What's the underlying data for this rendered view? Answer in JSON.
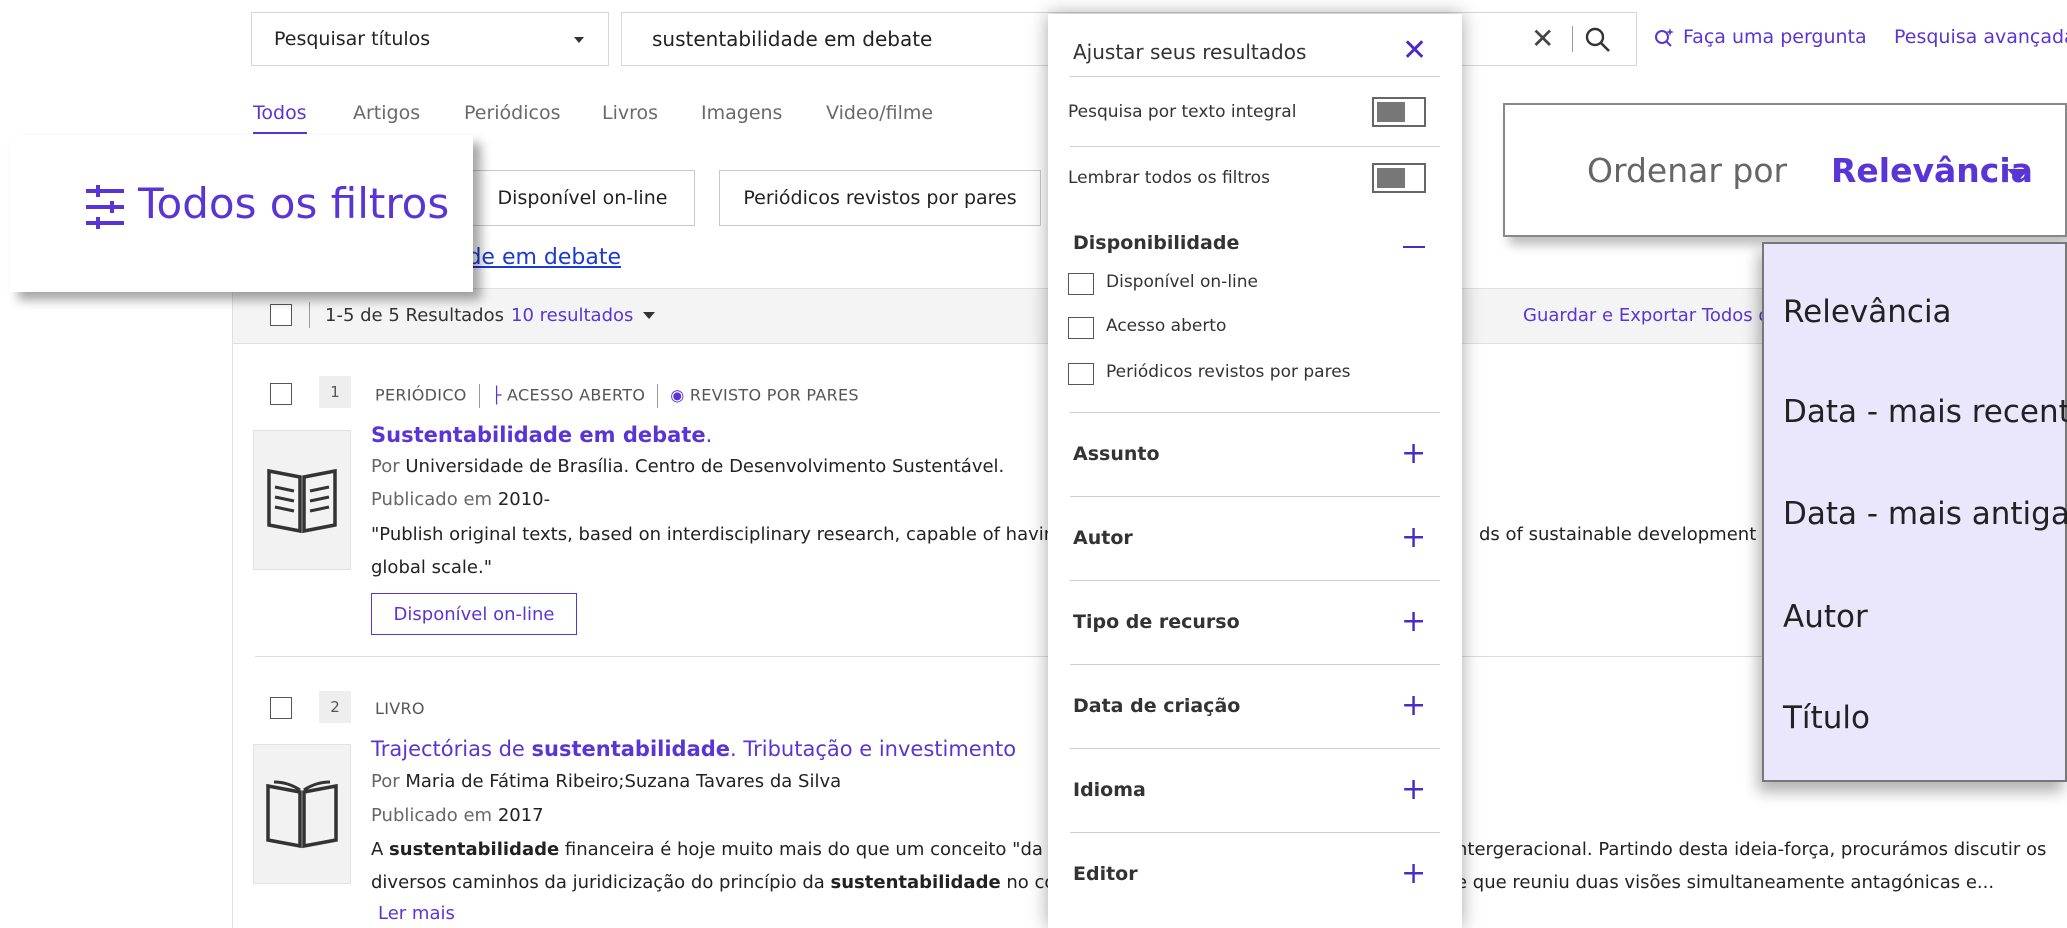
{
  "search": {
    "scope": "Pesquisar títulos",
    "query": "sustentabilidade em debate",
    "ask_label": "Faça uma pergunta",
    "advanced_label": "Pesquisa avançada"
  },
  "tabs": [
    "Todos",
    "Artigos",
    "Periódicos",
    "Livros",
    "Imagens",
    "Video/filme"
  ],
  "chips": [
    "Disponível on-line",
    "Periódicos revistos por pares"
  ],
  "query_link": "dade em debate",
  "results_bar": {
    "count": "1-5 de 5 Resultados",
    "pages": "10 resultados",
    "save_all": "Guardar e Exportar Todos o"
  },
  "results": [
    {
      "num": "1",
      "type": "PERIÓDICO",
      "open_access": "ACESSO ABERTO",
      "peer": "REVISTO POR PARES",
      "title_bold": "Sustentabilidade em debate",
      "title_rest": ".",
      "by_label": "Por",
      "author": "Universidade de Brasília. Centro de Desenvolvimento Sustentável.",
      "pub_label": "Publicado em",
      "pub": "2010-",
      "desc_left": "\"Publish original texts, based on interdisciplinary research, capable of having",
      "desc_right": "ds of sustainable development an",
      "desc_line2": "global scale.\"",
      "button": "Disponível on-line"
    },
    {
      "num": "2",
      "type": "LIVRO",
      "title_pre": "Trajectórias de ",
      "title_bold": "sustentabilidade",
      "title_rest": ". Tributação e investimento",
      "by_label": "Por",
      "author": "Maria de Fátima Ribeiro;Suzana Tavares da Silva",
      "pub_label": "Publicado em",
      "pub": "2017",
      "desc1_a": "A ",
      "desc1_b": "sustentabilidade",
      "desc1_c": " financeira é hoje muito mais do que um conceito \"da mo",
      "desc1_right": "ntergeracional. Partindo desta ideia-força, procurámos discutir os",
      "desc2_a": "diversos caminhos da juridicização do princípio da ",
      "desc2_b": "sustentabilidade",
      "desc2_c": " no cont",
      "desc2_right": "e que reuniu duas visões simultaneamente antagónicas e...",
      "read_more": "Ler mais"
    }
  ],
  "filters_panel": {
    "title": "Ajustar seus resultados",
    "fulltext": "Pesquisa por texto integral",
    "remember": "Lembrar todos os filtros",
    "availability": "Disponibilidade",
    "availability_options": [
      "Disponível on-line",
      "Acesso aberto",
      "Periódicos revistos por pares"
    ],
    "sections": [
      "Assunto",
      "Autor",
      "Tipo de recurso",
      "Data de criação",
      "Idioma",
      "Editor"
    ]
  },
  "all_filters_label": "Todos os filtros",
  "sort": {
    "label": "Ordenar por",
    "value": "Relevância",
    "options": [
      "Relevância",
      "Data - mais recente",
      "Data - mais antiga",
      "Autor",
      "Título"
    ]
  },
  "colors": {
    "accent": "#5a35d6",
    "link": "#1a3ad6",
    "menu_bg": "#eae6fb"
  }
}
